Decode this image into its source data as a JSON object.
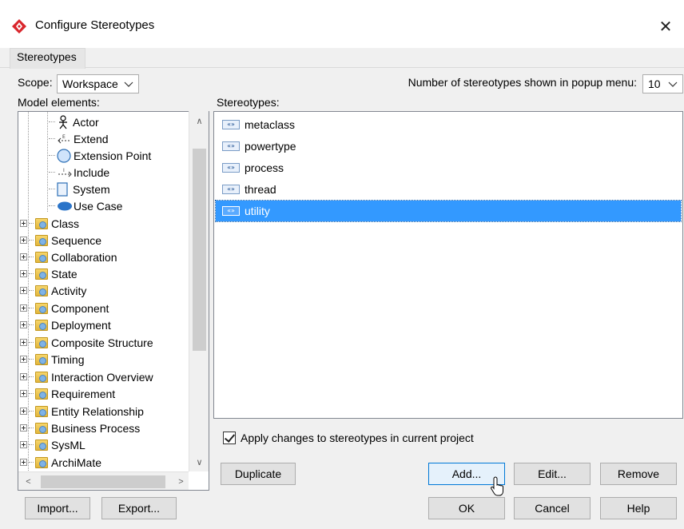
{
  "window": {
    "title": "Configure Stereotypes",
    "close_glyph": "✕",
    "colors": {
      "selection": "#3399ff",
      "brand_icon": "#d9262c"
    }
  },
  "tabs": [
    {
      "label": "Stereotypes",
      "active": true
    }
  ],
  "scope": {
    "label": "Scope:",
    "value": "Workspace"
  },
  "popup_count": {
    "label": "Number of stereotypes shown in popup menu:",
    "value": "10"
  },
  "model_elements": {
    "label": "Model elements:",
    "children": [
      {
        "label": "Actor",
        "icon": "actor-icon"
      },
      {
        "label": "Extend",
        "icon": "extend-icon"
      },
      {
        "label": "Extension Point",
        "icon": "extension-point-icon"
      },
      {
        "label": "Include",
        "icon": "include-icon"
      },
      {
        "label": "System",
        "icon": "system-icon"
      },
      {
        "label": "Use Case",
        "icon": "use-case-icon"
      }
    ],
    "folders": [
      "Class",
      "Sequence",
      "Collaboration",
      "State",
      "Activity",
      "Component",
      "Deployment",
      "Composite Structure",
      "Timing",
      "Interaction Overview",
      "Requirement",
      "Entity Relationship",
      "Business Process",
      "SysML",
      "ArchiMate"
    ],
    "scroll_up_glyph": "∧",
    "scroll_down_glyph": "∨",
    "scroll_left_glyph": "<",
    "scroll_right_glyph": ">"
  },
  "stereotypes": {
    "label": "Stereotypes:",
    "icon_glyph": "«»",
    "items": [
      {
        "label": "metaclass",
        "selected": false
      },
      {
        "label": "powertype",
        "selected": false
      },
      {
        "label": "process",
        "selected": false
      },
      {
        "label": "thread",
        "selected": false
      },
      {
        "label": "utility",
        "selected": true
      }
    ]
  },
  "apply_changes": {
    "label": "Apply changes to stereotypes in current project",
    "checked": true
  },
  "buttons": {
    "duplicate": "Duplicate",
    "add": "Add...",
    "edit": "Edit...",
    "remove": "Remove",
    "import": "Import...",
    "export": "Export...",
    "ok": "OK",
    "cancel": "Cancel",
    "help": "Help"
  }
}
